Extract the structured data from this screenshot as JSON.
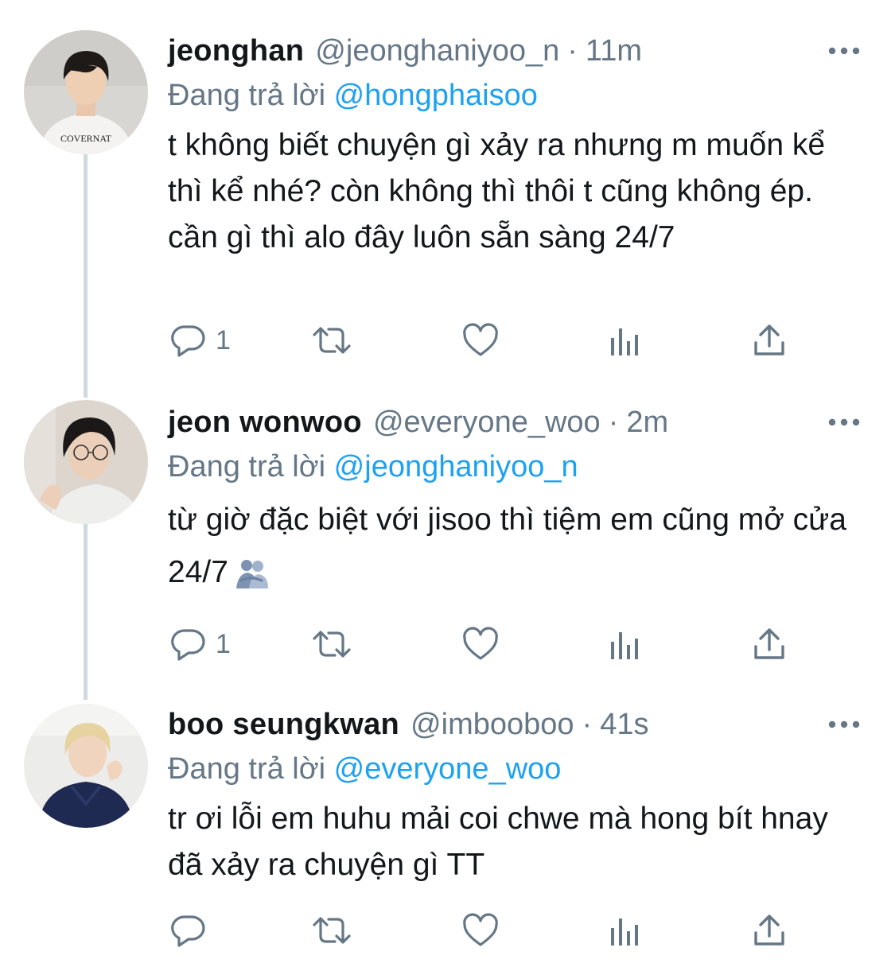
{
  "tweets": [
    {
      "display_name": "jeonghan",
      "handle": "@jeonghaniyoo_n",
      "separator": "·",
      "time": "11m",
      "reply_prefix": "Đang trả lời",
      "reply_to": "@hongphaisoo",
      "text": "t không biết chuyện gì xảy ra nhưng m muốn kể thì kể nhé? còn không thì thôi t cũng không ép. cần gì thì alo đây luôn sẵn sàng 24/7",
      "reply_count": "1",
      "avatar_shirt_text": "COVERNAT"
    },
    {
      "display_name": "jeon wonwoo",
      "handle": "@everyone_woo",
      "separator": "·",
      "time": "2m",
      "reply_prefix": "Đang trả lời",
      "reply_to": "@jeonghaniyoo_n",
      "text": "từ giờ đặc biệt với jisoo thì tiệm em cũng mở cửa 24/7",
      "emoji": "people-hugging-emoji",
      "reply_count": "1"
    },
    {
      "display_name": "boo seungkwan",
      "handle": "@imbooboo",
      "separator": "·",
      "time": "41s",
      "reply_prefix": "Đang trả lời",
      "reply_to": "@everyone_woo",
      "text": "tr ơi lỗi em huhu mải coi chwe mà hong bít hnay đã xảy ra chuyện gì TT",
      "reply_count": ""
    }
  ],
  "icons": {
    "reply": "comment-bubble-icon",
    "retweet": "retweet-icon",
    "like": "heart-icon",
    "analytics": "bar-chart-icon",
    "share": "share-upload-icon",
    "more": "more-dots-icon"
  },
  "colors": {
    "text": "#14171a",
    "secondary": "#657786",
    "link": "#1da1f2",
    "thread_line": "#cfd9de",
    "icon": "#657786"
  }
}
